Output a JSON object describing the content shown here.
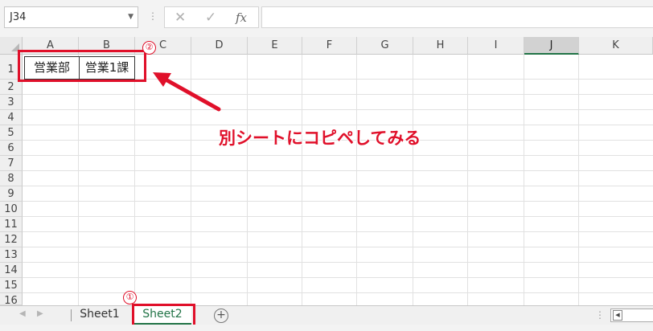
{
  "formula_bar": {
    "name_box": "J34",
    "fx_label": "fx",
    "formula_value": ""
  },
  "grid": {
    "columns": [
      "A",
      "B",
      "C",
      "D",
      "E",
      "F",
      "G",
      "H",
      "I",
      "J",
      "K"
    ],
    "selected_column": "J",
    "rows": [
      "1",
      "2",
      "3",
      "4",
      "5",
      "6",
      "7",
      "8",
      "9",
      "10",
      "11",
      "12",
      "13",
      "14",
      "15",
      "16"
    ],
    "cells": {
      "A1": "営業部",
      "B1": "営業1課"
    }
  },
  "annotations": {
    "marker_1": "①",
    "marker_2": "②",
    "callout": "別シートにコピペしてみる",
    "accent_color": "#e0102a"
  },
  "sheet_tabs": {
    "tabs": [
      "Sheet1",
      "Sheet2"
    ],
    "active": "Sheet2",
    "active_color": "#217346"
  },
  "icons": {
    "cancel": "close-icon",
    "enter": "check-icon",
    "function": "fx-icon",
    "add_sheet": "plus-circle-icon"
  }
}
